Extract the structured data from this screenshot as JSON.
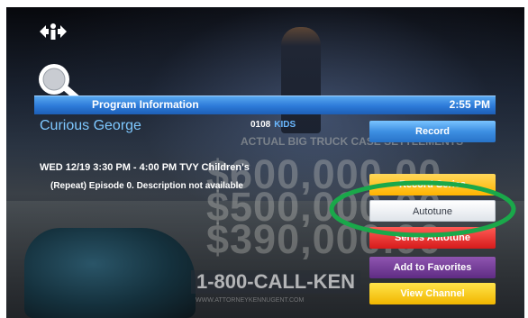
{
  "header": {
    "title": "Program Information",
    "time": "2:55 PM"
  },
  "program": {
    "title": "Curious George",
    "channel_number": "0108",
    "channel_name": "KIDS",
    "air_line": "WED 12/19 3:30 PM - 4:00 PM  TVY Children's",
    "description": "(Repeat) Episode 0. Description not available"
  },
  "menu": {
    "items": [
      {
        "label": "Record"
      },
      {
        "label": "Record Series"
      },
      {
        "label": "Autotune"
      },
      {
        "label": "Series Autotune"
      },
      {
        "label": "Add to Favorites"
      },
      {
        "label": "View Channel"
      }
    ]
  },
  "background": {
    "truck_text": "ACTUAL BIG TRUCK CASE SETTLEMENTS",
    "amounts": [
      "$600,000.00",
      "$500,000.00",
      "$390,000.00"
    ],
    "phone": "1-800-CALL-KEN",
    "url": "WWW.ATTORNEYKENNUGENT.COM"
  },
  "annotation": {
    "color": "#1aa84a"
  }
}
